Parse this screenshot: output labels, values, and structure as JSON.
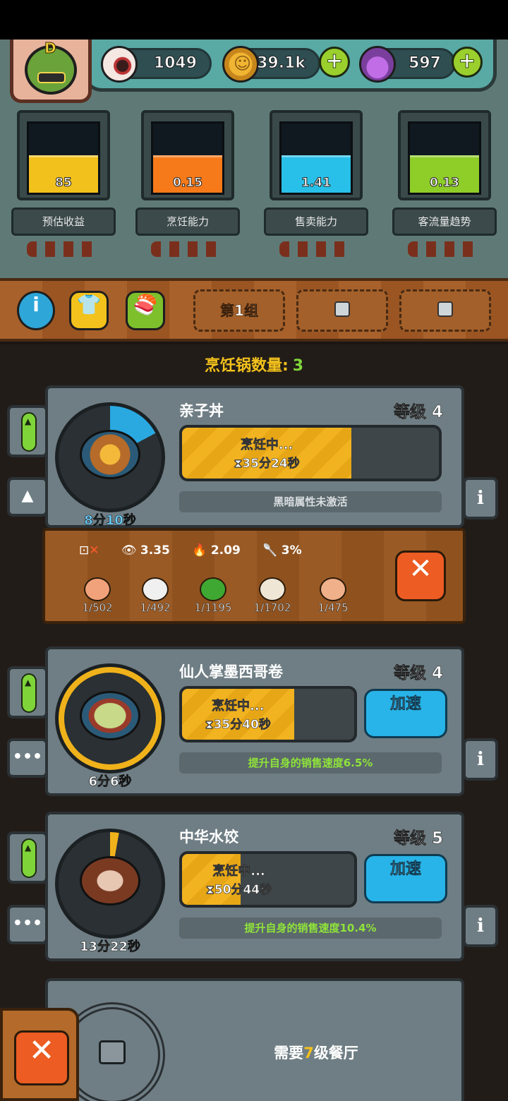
{
  "top": {
    "rank": "D",
    "eyes": "1049",
    "coins": "39.1k",
    "potions": "597",
    "plus_label": "+"
  },
  "stats": [
    {
      "value": "85",
      "label": "预估收益",
      "color": "#f3c11c"
    },
    {
      "value": "0.15",
      "label": "烹饪能力",
      "color": "#f77a1a"
    },
    {
      "value": "1.41",
      "label": "售卖能力",
      "color": "#28c0e8"
    },
    {
      "value": "0.13",
      "label": "客流量趋势",
      "color": "#8fcd28"
    }
  ],
  "tabs": {
    "info_icon": "i",
    "group1": "第1组"
  },
  "pot_count": {
    "label": "烹饪锅数量:",
    "value": "3"
  },
  "recipes": [
    {
      "name": "亲子丼",
      "level": "等级 4",
      "time": "8分10秒",
      "status": "烹饪中...",
      "remaining": "⧗35分24秒",
      "progress": 0.66,
      "effect": "黑暗属性未激活",
      "effect_color": "#d8dde0"
    },
    {
      "name": "仙人掌墨西哥卷",
      "level": "等级 4",
      "time": "6分6秒",
      "status": "烹饪中...",
      "remaining": "⧗35分40秒",
      "progress": 0.65,
      "effect": "提升自身的销售速度6.5%",
      "effect_color": "#8fe33a",
      "speed_label": "加速"
    },
    {
      "name": "中华水饺",
      "level": "等级 5",
      "time": "13分22秒",
      "status": "烹饪中...",
      "remaining": "⧗50分44秒",
      "progress": 0.34,
      "effect": "提升自身的销售速度10.4%",
      "effect_color": "#8fe33a",
      "speed_label": "加速"
    }
  ],
  "ingredients_panel": {
    "stat_eye": "3.35",
    "stat_fire": "2.09",
    "stat_spoon": "3%",
    "items": [
      {
        "qty": "1/502",
        "color": "#f2a27a"
      },
      {
        "qty": "1/492",
        "color": "#f0f0f0"
      },
      {
        "qty": "1/1195",
        "color": "#3fa832"
      },
      {
        "qty": "1/1702",
        "color": "#efe6d6"
      },
      {
        "qty": "1/475",
        "color": "#f0b08a"
      }
    ]
  },
  "locked": {
    "prefix": "需要",
    "level": "7",
    "suffix": "级餐厅"
  },
  "icons": [
    "eye-icon",
    "coin-icon",
    "potion-icon",
    "plus-icon",
    "info-icon",
    "shirt-icon",
    "food-icon",
    "lock-icon",
    "close-icon",
    "more-icon",
    "hourglass-icon"
  ]
}
